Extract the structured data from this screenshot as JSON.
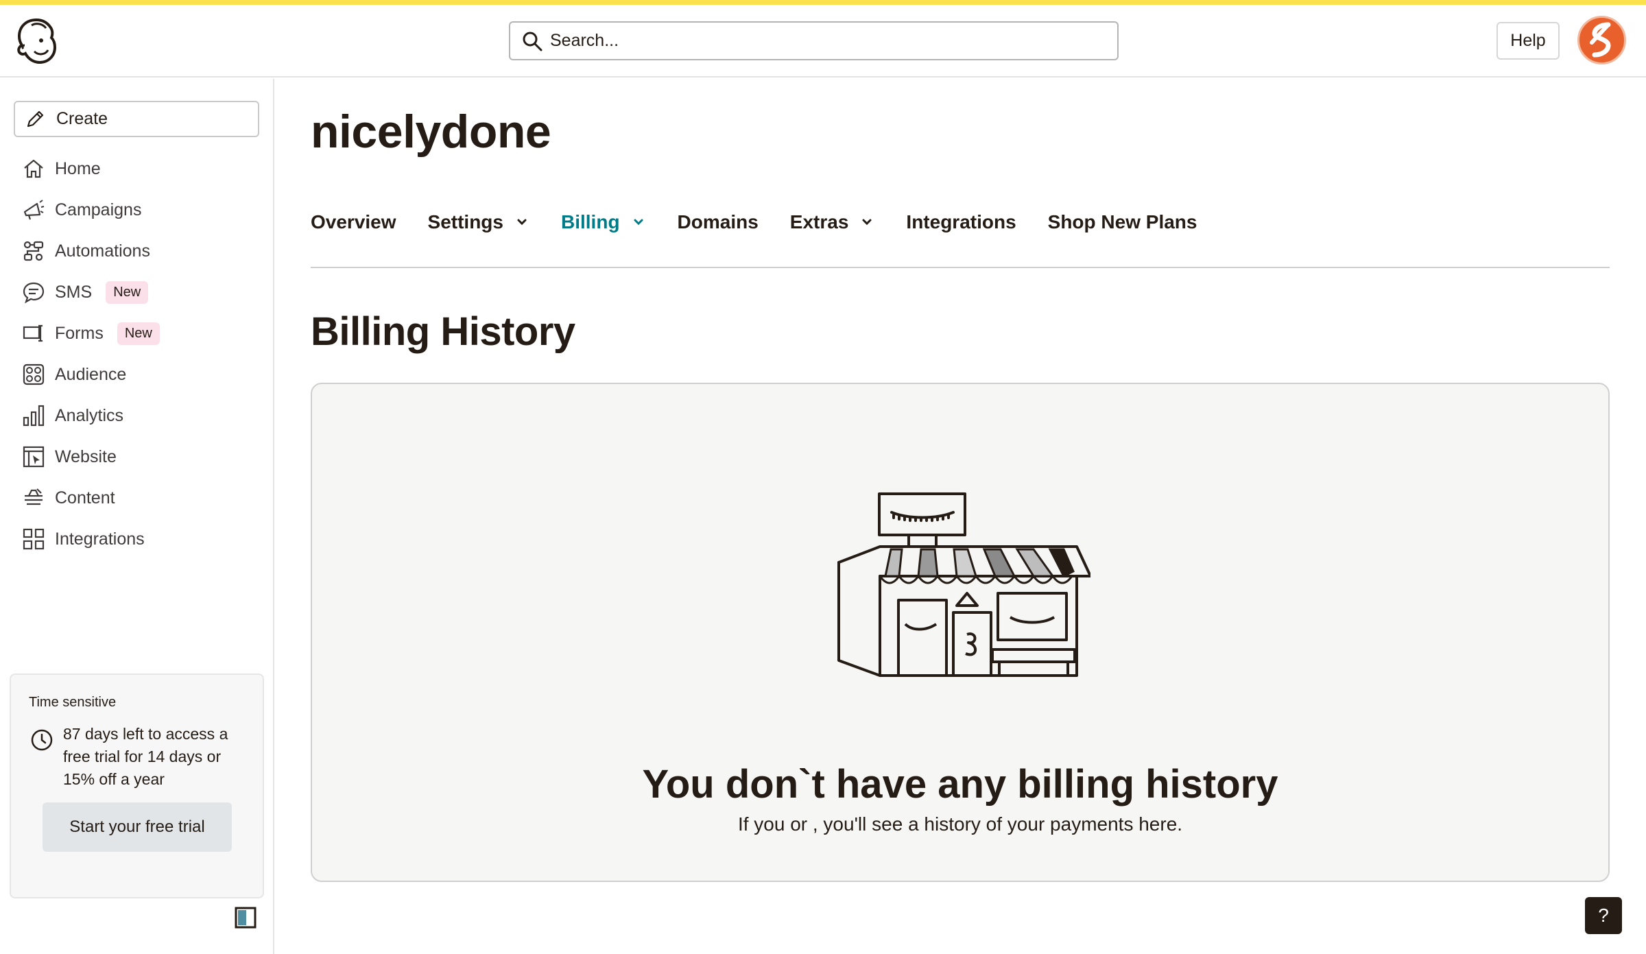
{
  "header": {
    "search_placeholder": "Search...",
    "help_label": "Help"
  },
  "sidebar": {
    "create_label": "Create",
    "items": [
      {
        "label": "Home",
        "icon": "home-icon"
      },
      {
        "label": "Campaigns",
        "icon": "megaphone-icon"
      },
      {
        "label": "Automations",
        "icon": "automations-icon"
      },
      {
        "label": "SMS",
        "icon": "sms-icon",
        "badge": "New"
      },
      {
        "label": "Forms",
        "icon": "forms-icon",
        "badge": "New"
      },
      {
        "label": "Audience",
        "icon": "audience-icon"
      },
      {
        "label": "Analytics",
        "icon": "analytics-icon"
      },
      {
        "label": "Website",
        "icon": "website-icon"
      },
      {
        "label": "Content",
        "icon": "content-icon"
      },
      {
        "label": "Integrations",
        "icon": "integrations-icon"
      }
    ],
    "trial": {
      "label": "Time sensitive",
      "text": "87 days left to access a free trial for 14 days or 15% off a year",
      "button": "Start your free trial"
    }
  },
  "main": {
    "title": "nicelydone",
    "tabs": [
      {
        "label": "Overview"
      },
      {
        "label": "Settings"
      },
      {
        "label": "Billing"
      },
      {
        "label": "Domains"
      },
      {
        "label": "Extras"
      },
      {
        "label": "Integrations"
      },
      {
        "label": "Shop New Plans"
      }
    ],
    "section_title": "Billing History",
    "empty_title": "You don`t have any billing history",
    "empty_subtitle": "If you or , you'll see a history of your payments here."
  },
  "help_fab": "?",
  "colors": {
    "accent_bar": "#fbe14b",
    "active_tab": "#007c89",
    "badge_bg": "#fbe0ea",
    "avatar": "#e8602c"
  }
}
